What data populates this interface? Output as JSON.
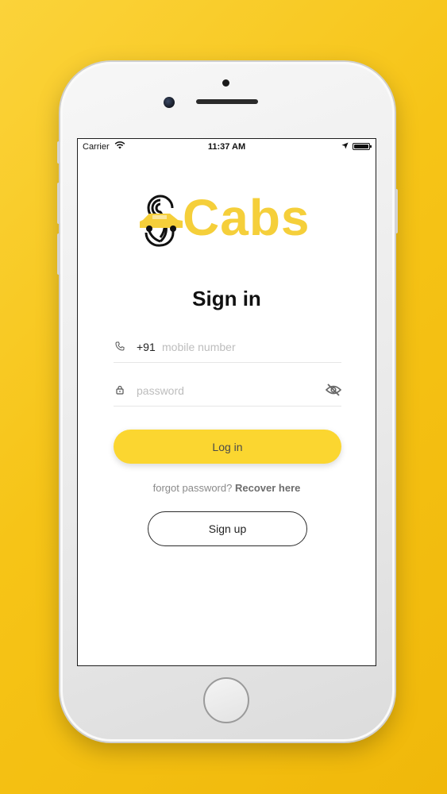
{
  "status_bar": {
    "carrier": "Carrier",
    "time": "11:37 AM"
  },
  "logo": {
    "text": "Cabs",
    "mark_label": "TAXI",
    "brand_color": "#f5cf3a"
  },
  "signin": {
    "title": "Sign in",
    "phone_prefix": "+91",
    "phone_placeholder": "mobile number",
    "password_placeholder": "password",
    "login_label": "Log in",
    "forgot_text": "forgot password?",
    "recover_link": "Recover here",
    "signup_label": "Sign up"
  },
  "icons": {
    "phone": "phone-icon",
    "lock": "lock-icon",
    "eye": "eye-off-icon",
    "wifi": "wifi-icon",
    "location": "location-arrow-icon",
    "battery": "battery-icon"
  },
  "colors": {
    "background": "#f6c417",
    "button": "#fbd630"
  }
}
